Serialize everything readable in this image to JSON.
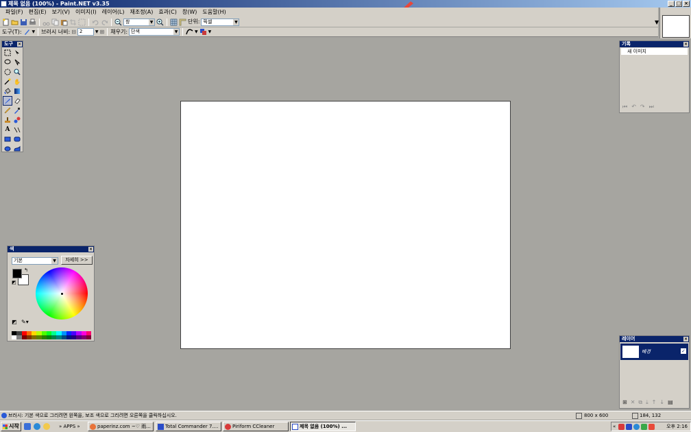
{
  "window": {
    "title": "제목 없음 (100%) - Paint.NET v3.35",
    "min": "_",
    "max": "□",
    "close": "×"
  },
  "menu": [
    "파일(F)",
    "편집(E)",
    "보기(V)",
    "이미지(I)",
    "레이어(L)",
    "재조정(A)",
    "효과(C)",
    "창(W)",
    "도움말(H)"
  ],
  "toolbar1": {
    "zoom_value": "창",
    "units_label": "단위:",
    "units_value": "픽셀"
  },
  "toolbar2": {
    "tool_label": "도구(T):",
    "brush_width_label": "브러시 너비:",
    "brush_width_value": "2",
    "fill_label": "채우기:",
    "fill_value": "단색"
  },
  "tools_panel": {
    "title": "도구"
  },
  "history_panel": {
    "title": "기록",
    "items": [
      "새 이미지"
    ]
  },
  "colors_panel": {
    "title": "색",
    "mode": "기본",
    "more_button": "자세히 >>",
    "primary_color": "#000000",
    "secondary_color": "#ffffff",
    "palette": [
      "#000000",
      "#404040",
      "#ff0000",
      "#ff6a00",
      "#ffd800",
      "#b6ff00",
      "#4cff00",
      "#00ff21",
      "#00ff90",
      "#00ffff",
      "#0094ff",
      "#0026ff",
      "#4800ff",
      "#b200ff",
      "#ff00dc",
      "#ff006e",
      "#ffffff",
      "#808080",
      "#7f0000",
      "#7f3300",
      "#7f6a00",
      "#5b7f00",
      "#267f00",
      "#007f0e",
      "#007f46",
      "#007f7f",
      "#004a7f",
      "#00137f",
      "#21007f",
      "#57007f",
      "#7f006e",
      "#7f0037"
    ]
  },
  "layers_panel": {
    "title": "레이어",
    "layers": [
      {
        "name": "배경",
        "visible": true
      }
    ]
  },
  "status": {
    "hint": "브러시: 기본 색으로 그리려면 왼쪽을, 보조 색으로 그리려면 오른쪽을 클릭하십시오.",
    "image_size": "800 x 600",
    "cursor_pos": "184, 132"
  },
  "taskbar": {
    "start": "시작",
    "apps_label": "» APPS »",
    "tasks": [
      "paperinz.com ~♡ 雨...",
      "Total Commander 7....",
      "Piriform CCleaner",
      "제목 없음 (100%) ..."
    ],
    "clock": "오후 2:16"
  }
}
